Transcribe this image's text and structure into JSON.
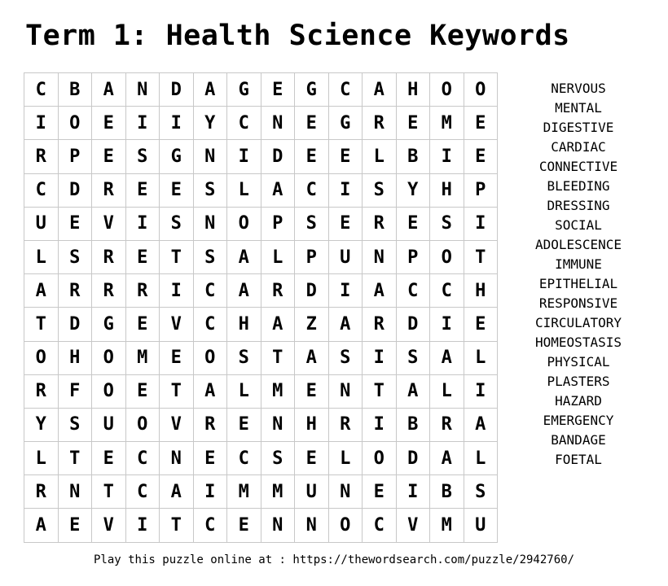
{
  "title": "Term 1: Health Science Keywords",
  "grid": [
    [
      "C",
      "B",
      "A",
      "N",
      "D",
      "A",
      "G",
      "E",
      "G",
      "C",
      "A",
      "H",
      "O",
      "O"
    ],
    [
      "I",
      "O",
      "E",
      "I",
      "I",
      "Y",
      "C",
      "N",
      "E",
      "G",
      "R",
      "E",
      "M",
      "E"
    ],
    [
      "R",
      "P",
      "E",
      "S",
      "G",
      "N",
      "I",
      "D",
      "E",
      "E",
      "L",
      "B",
      "I",
      "E"
    ],
    [
      "C",
      "D",
      "R",
      "E",
      "E",
      "S",
      "L",
      "A",
      "C",
      "I",
      "S",
      "Y",
      "H",
      "P"
    ],
    [
      "U",
      "E",
      "V",
      "I",
      "S",
      "N",
      "O",
      "P",
      "S",
      "E",
      "R",
      "E",
      "S",
      "I"
    ],
    [
      "L",
      "S",
      "R",
      "E",
      "T",
      "S",
      "A",
      "L",
      "P",
      "U",
      "N",
      "P",
      "O",
      "T"
    ],
    [
      "A",
      "R",
      "R",
      "R",
      "I",
      "C",
      "A",
      "R",
      "D",
      "I",
      "A",
      "C",
      "C",
      "H"
    ],
    [
      "T",
      "D",
      "G",
      "E",
      "V",
      "C",
      "H",
      "A",
      "Z",
      "A",
      "R",
      "D",
      "I",
      "E"
    ],
    [
      "O",
      "H",
      "O",
      "M",
      "E",
      "O",
      "S",
      "T",
      "A",
      "S",
      "I",
      "S",
      "A",
      "L"
    ],
    [
      "R",
      "F",
      "O",
      "E",
      "T",
      "A",
      "L",
      "M",
      "E",
      "N",
      "T",
      "A",
      "L",
      "I"
    ],
    [
      "Y",
      "S",
      "U",
      "O",
      "V",
      "R",
      "E",
      "N",
      "H",
      "R",
      "I",
      "B",
      "R",
      "A"
    ],
    [
      "L",
      "T",
      "E",
      "C",
      "N",
      "E",
      "C",
      "S",
      "E",
      "L",
      "O",
      "D",
      "A",
      "L"
    ],
    [
      "R",
      "N",
      "T",
      "C",
      "A",
      "I",
      "M",
      "M",
      "U",
      "N",
      "E",
      "I",
      "B",
      "S"
    ],
    [
      "A",
      "E",
      "V",
      "I",
      "T",
      "C",
      "E",
      "N",
      "N",
      "O",
      "C",
      "V",
      "M",
      "U"
    ]
  ],
  "words": [
    "NERVOUS",
    "MENTAL",
    "DIGESTIVE",
    "CARDIAC",
    "CONNECTIVE",
    "BLEEDING",
    "DRESSING",
    "SOCIAL",
    "ADOLESCENCE",
    "IMMUNE",
    "EPITHELIAL",
    "RESPONSIVE",
    "CIRCULATORY",
    "HOMEOSTASIS",
    "PHYSICAL",
    "PLASTERS",
    "HAZARD",
    "EMERGENCY",
    "BANDAGE",
    "FOETAL"
  ],
  "footer": "Play this puzzle online at : https://thewordsearch.com/puzzle/2942760/"
}
